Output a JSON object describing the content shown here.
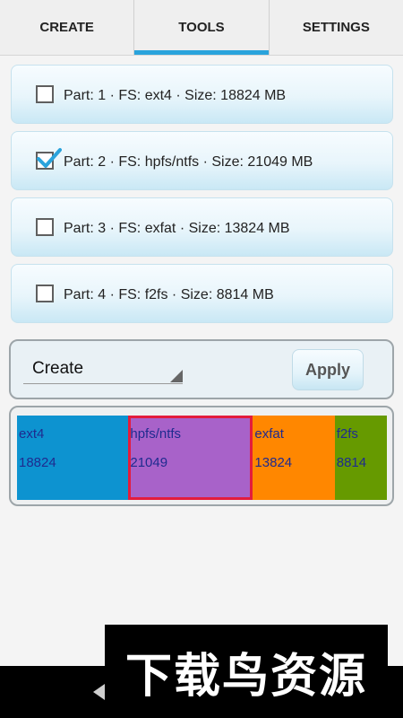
{
  "tabs": [
    {
      "label": "CREATE",
      "active": false
    },
    {
      "label": "TOOLS",
      "active": true
    },
    {
      "label": "SETTINGS",
      "active": false
    }
  ],
  "partitions": [
    {
      "label": "Part: 1 · FS: ext4 · Size: 18824 MB",
      "checked": false
    },
    {
      "label": "Part: 2 · FS: hpfs/ntfs · Size: 21049 MB",
      "checked": true
    },
    {
      "label": "Part: 3 · FS: exfat · Size: 13824 MB",
      "checked": false
    },
    {
      "label": "Part: 4 · FS: f2fs · Size: 8814 MB",
      "checked": false
    }
  ],
  "action": {
    "selected_value": "Create",
    "apply_label": "Apply"
  },
  "partition_map": [
    {
      "fs": "ext4",
      "size": "18824",
      "value": 18824,
      "color": "#0d93d0"
    },
    {
      "fs": "hpfs/ntfs",
      "size": "21049",
      "value": 21049,
      "color": "#a862c9"
    },
    {
      "fs": "exfat",
      "size": "13824",
      "value": 13824,
      "color": "#ff8700"
    },
    {
      "fs": "f2fs",
      "size": "8814",
      "value": 8814,
      "color": "#669a00"
    }
  ],
  "selected_partition": 2,
  "colors": {
    "accent": "#2aa3dc",
    "selection_border": "#e31c3d"
  },
  "watermark": "下载鸟资源"
}
